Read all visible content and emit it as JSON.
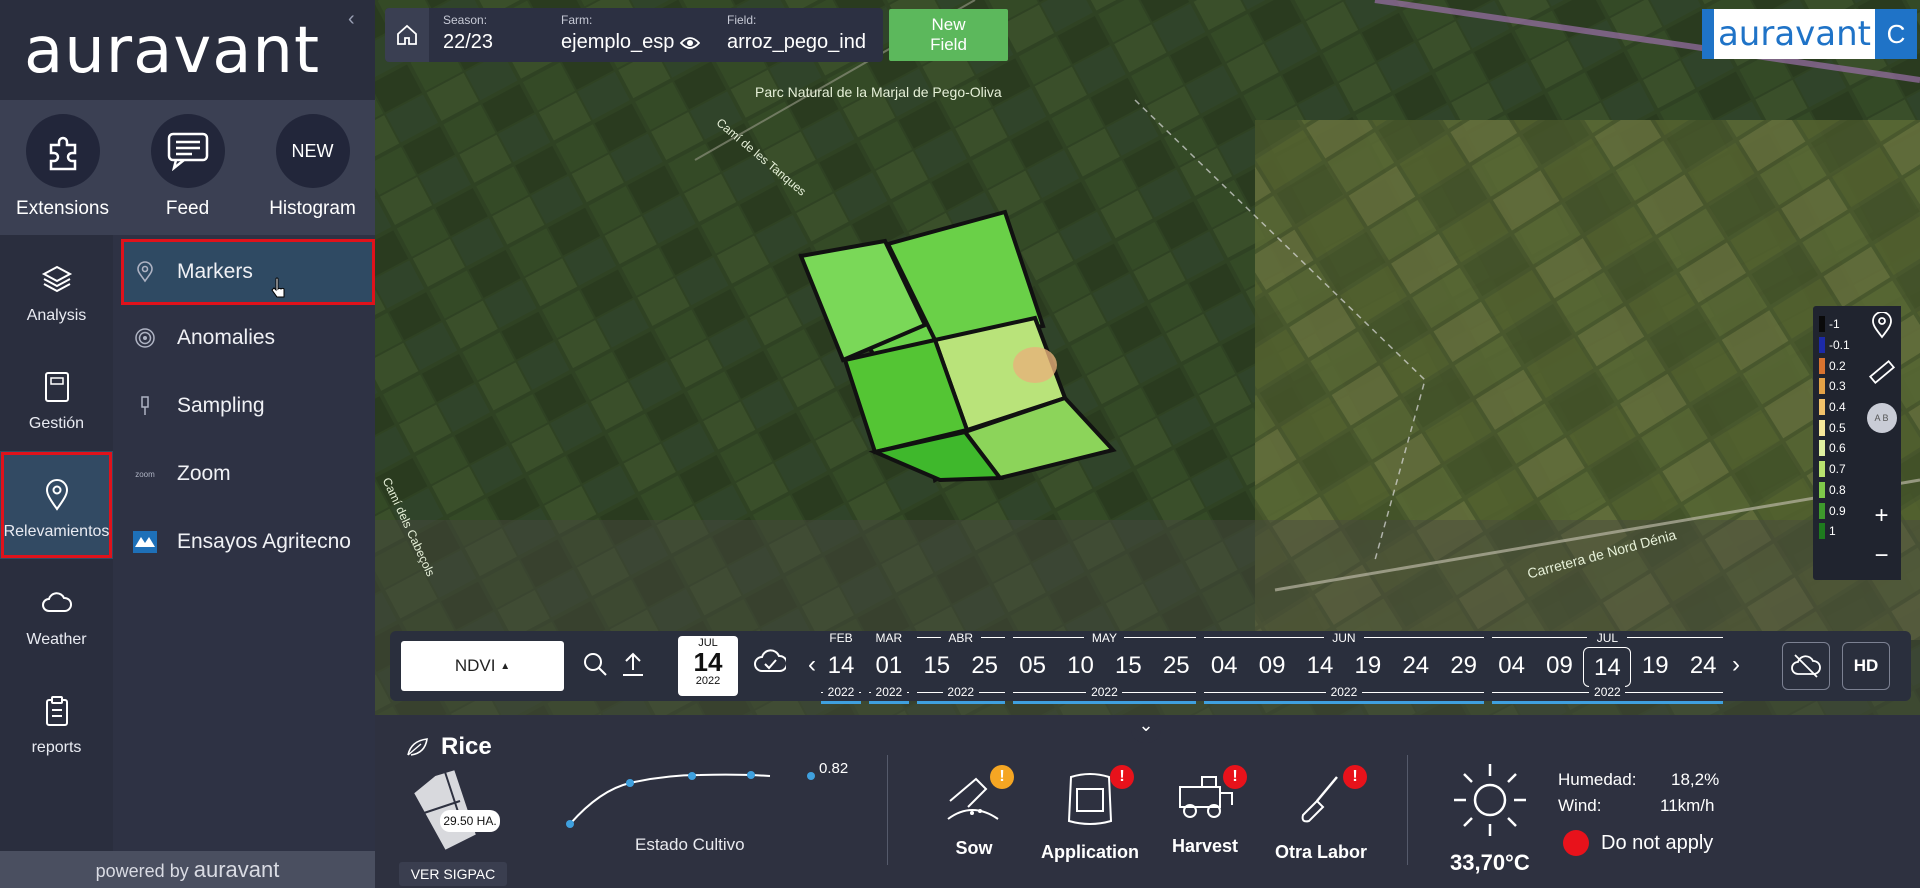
{
  "brand": {
    "logo": "auravant",
    "collapse_icon": "chevron-left-icon"
  },
  "quick": [
    {
      "label": "Extensions",
      "icon": "puzzle-icon"
    },
    {
      "label": "Feed",
      "icon": "chat-icon"
    },
    {
      "label": "Histogram",
      "badge": "NEW"
    }
  ],
  "rail": [
    {
      "label": "Analysis",
      "icon": "layers-icon"
    },
    {
      "label": "Gestión",
      "icon": "notebook-icon"
    },
    {
      "label": "Relevamientos",
      "icon": "map-pin-icon",
      "active": true
    },
    {
      "label": "Weather",
      "icon": "cloud-icon"
    },
    {
      "label": "reports",
      "icon": "clipboard-icon"
    }
  ],
  "submenu": [
    {
      "label": "Markers",
      "icon": "map-pin-icon",
      "active": true
    },
    {
      "label": "Anomalies",
      "icon": "radar-icon"
    },
    {
      "label": "Sampling",
      "icon": "probe-icon"
    },
    {
      "label": "Zoom",
      "icon": "zoom-icon"
    },
    {
      "label": "Ensayos Agritecno",
      "icon": "agritecno-logo-icon"
    }
  ],
  "powered": {
    "prefix": "powered by",
    "brand": "auravant"
  },
  "topbar": {
    "season_label": "Season:",
    "season": "22/23",
    "farm_label": "Farm:",
    "farm": "ejemplo_esp",
    "field_label": "Field:",
    "field": "arroz_pego_ind",
    "new_field_line1": "New",
    "new_field_line2": "Field",
    "logo": "auravant",
    "logo_tail": "C"
  },
  "map": {
    "park_label": "Parc Natural de la Marjal de Pego-Oliva",
    "road1": "Camí de les Tanques",
    "road2": "Carretera de Nord Dénia",
    "road3": "Camí dels Cabeçols"
  },
  "legend": [
    {
      "label": "-1",
      "color": "#0a0a0a"
    },
    {
      "label": "-0.1",
      "color": "#1c2aa8"
    },
    {
      "label": "0.2",
      "color": "#d9732f"
    },
    {
      "label": "0.3",
      "color": "#e4a246"
    },
    {
      "label": "0.4",
      "color": "#f2c26a"
    },
    {
      "label": "0.5",
      "color": "#f6e79a"
    },
    {
      "label": "0.6",
      "color": "#dff0a0"
    },
    {
      "label": "0.7",
      "color": "#b8e26e"
    },
    {
      "label": "0.8",
      "color": "#7fc94a"
    },
    {
      "label": "0.9",
      "color": "#3e9a2c"
    },
    {
      "label": "1",
      "color": "#1e7a1e"
    }
  ],
  "tools": {
    "plus": "+",
    "minus": "−",
    "ab": "A B"
  },
  "timeline": {
    "index": "NDVI",
    "badge_month": "JUL",
    "badge_day": "14",
    "badge_year": "2022",
    "months": [
      {
        "label": "FEB"
      },
      {
        "label": "MAR"
      },
      {
        "label": "ABR"
      },
      {
        "label": "MAY"
      },
      {
        "label": "JUN"
      },
      {
        "label": "JUL"
      }
    ],
    "days": [
      "14",
      "01",
      "15",
      "25",
      "05",
      "10",
      "15",
      "25",
      "04",
      "09",
      "14",
      "19",
      "24",
      "29",
      "04",
      "09",
      "14",
      "19",
      "24"
    ],
    "years": [
      "2022",
      "2022",
      "2022",
      "2022",
      "2022",
      "2022"
    ],
    "hd": "HD"
  },
  "bottom": {
    "crop": "Rice",
    "area": "29.50 HA.",
    "sigpac": "VER SIGPAC",
    "ndvi_value": "0.82",
    "estado": "Estado Cultivo",
    "tasks": [
      {
        "label": "Sow",
        "icon": "seeding-hand-icon",
        "warn": "#f5a623"
      },
      {
        "label": "Application",
        "icon": "fertilizer-bag-icon",
        "warn": "#e8121b"
      },
      {
        "label": "Harvest",
        "icon": "harvester-icon",
        "warn": "#e8121b"
      },
      {
        "label": "Otra Labor",
        "icon": "shovel-icon",
        "warn": "#e8121b"
      }
    ],
    "temp": "33,70°C",
    "humidity_label": "Humedad:",
    "humidity": "18,2%",
    "wind_label": "Wind:",
    "wind": "11km/h",
    "do_not_apply": "Do not apply"
  }
}
